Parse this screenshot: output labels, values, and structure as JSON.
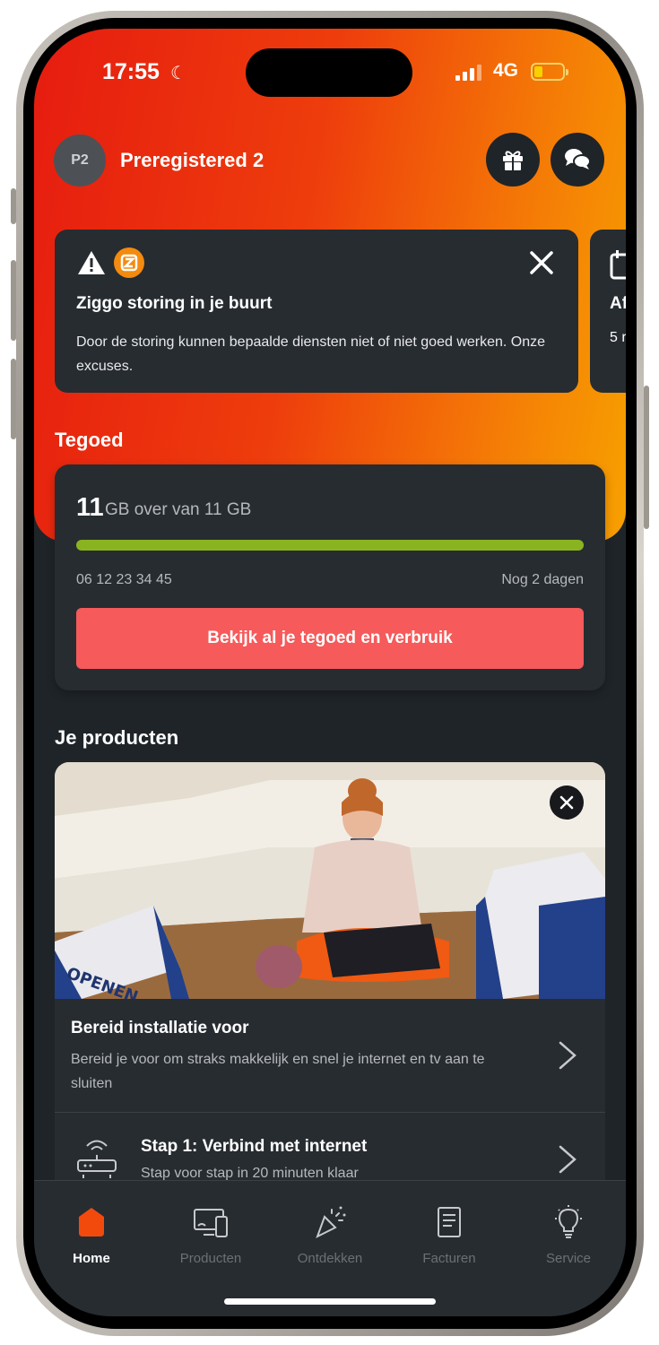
{
  "status_bar": {
    "time": "17:55",
    "network": "4G"
  },
  "header": {
    "avatar_initials": "P2",
    "user_name": "Preregistered 2",
    "gift_icon": "gift-icon",
    "chat_icon": "chat-icon"
  },
  "alert": {
    "title": "Ziggo storing in je buurt",
    "body": "Door de storing kunnen bepaalde diensten niet of niet goed werken. Onze excuses.",
    "peek_title": "Af",
    "peek_body": "5 r"
  },
  "credit": {
    "section_title": "Tegoed",
    "amount": "11",
    "amount_suffix": "GB over van 11 GB",
    "usage_fraction": 1.0,
    "phone_number": "06 12 23 34 45",
    "remaining": "Nog 2 dagen",
    "cta_label": "Bekijk al je tegoed en verbruik"
  },
  "products": {
    "section_title": "Je producten",
    "card_title": "Bereid installatie voor",
    "card_desc": "Bereid je voor om straks makkelijk en snel je internet en tv aan te sluiten",
    "step_title": "Stap 1: Verbind met internet",
    "step_desc": "Stap voor stap in 20 minuten klaar",
    "photo_box_text": "OPENEN"
  },
  "tabs": [
    {
      "label": "Home",
      "icon": "home-icon"
    },
    {
      "label": "Producten",
      "icon": "devices-icon"
    },
    {
      "label": "Ontdekken",
      "icon": "party-icon"
    },
    {
      "label": "Facturen",
      "icon": "invoice-icon"
    },
    {
      "label": "Service",
      "icon": "lightbulb-icon"
    }
  ],
  "colors": {
    "accent": "#f65a5a",
    "brand_orange": "#f57f06",
    "brand_red": "#e61c10",
    "progress": "#8ab41f",
    "card": "#272c31"
  }
}
